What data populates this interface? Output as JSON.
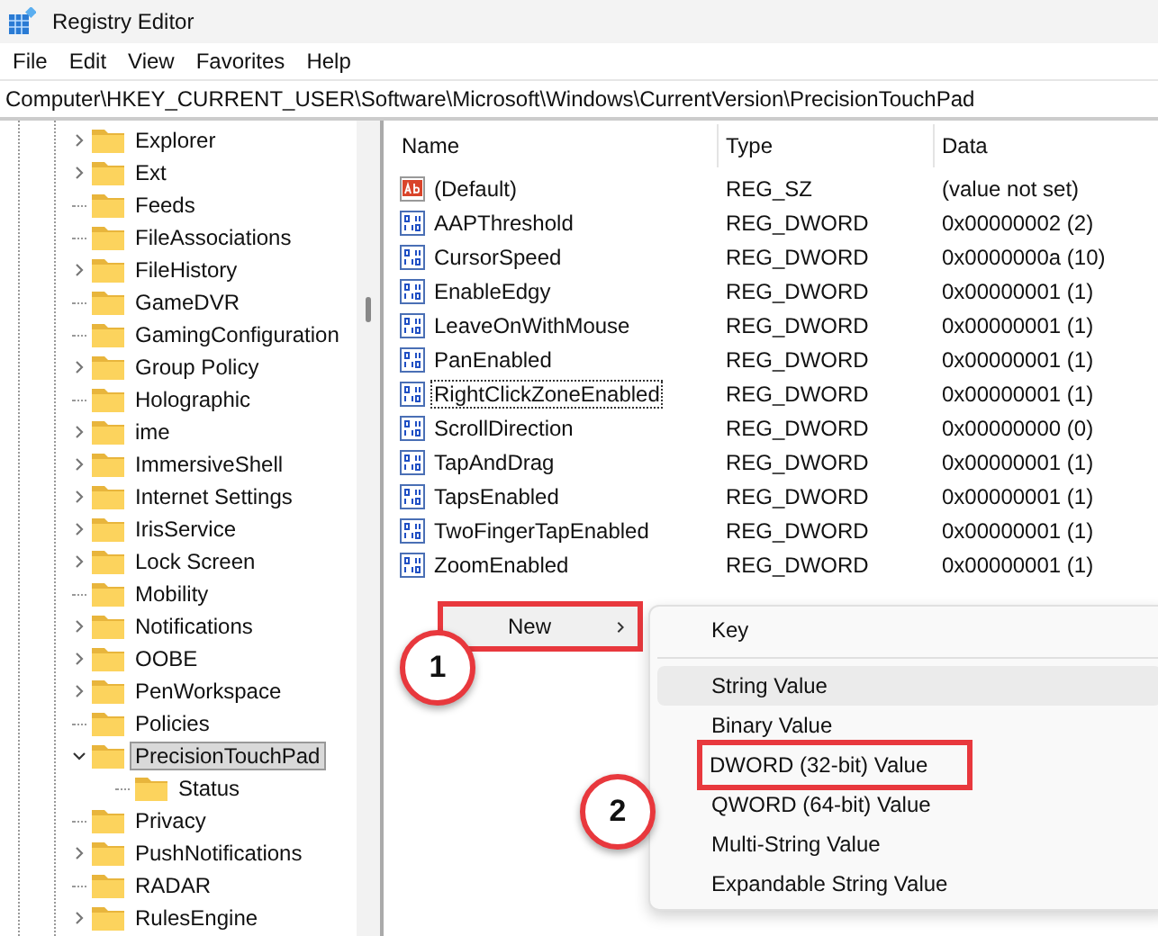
{
  "window": {
    "title": "Registry Editor"
  },
  "menu": [
    "File",
    "Edit",
    "View",
    "Favorites",
    "Help"
  ],
  "address": "Computer\\HKEY_CURRENT_USER\\Software\\Microsoft\\Windows\\CurrentVersion\\PrecisionTouchPad",
  "tree": [
    {
      "label": "Explorer",
      "expandable": true,
      "expanded": false,
      "selected": false
    },
    {
      "label": "Ext",
      "expandable": true,
      "expanded": false,
      "selected": false
    },
    {
      "label": "Feeds",
      "expandable": false,
      "expanded": false,
      "selected": false
    },
    {
      "label": "FileAssociations",
      "expandable": false,
      "expanded": false,
      "selected": false
    },
    {
      "label": "FileHistory",
      "expandable": true,
      "expanded": false,
      "selected": false
    },
    {
      "label": "GameDVR",
      "expandable": false,
      "expanded": false,
      "selected": false
    },
    {
      "label": "GamingConfiguration",
      "expandable": false,
      "expanded": false,
      "selected": false
    },
    {
      "label": "Group Policy",
      "expandable": true,
      "expanded": false,
      "selected": false
    },
    {
      "label": "Holographic",
      "expandable": false,
      "expanded": false,
      "selected": false
    },
    {
      "label": "ime",
      "expandable": true,
      "expanded": false,
      "selected": false
    },
    {
      "label": "ImmersiveShell",
      "expandable": true,
      "expanded": false,
      "selected": false
    },
    {
      "label": "Internet Settings",
      "expandable": true,
      "expanded": false,
      "selected": false
    },
    {
      "label": "IrisService",
      "expandable": true,
      "expanded": false,
      "selected": false
    },
    {
      "label": "Lock Screen",
      "expandable": true,
      "expanded": false,
      "selected": false
    },
    {
      "label": "Mobility",
      "expandable": false,
      "expanded": false,
      "selected": false
    },
    {
      "label": "Notifications",
      "expandable": true,
      "expanded": false,
      "selected": false
    },
    {
      "label": "OOBE",
      "expandable": true,
      "expanded": false,
      "selected": false
    },
    {
      "label": "PenWorkspace",
      "expandable": true,
      "expanded": false,
      "selected": false
    },
    {
      "label": "Policies",
      "expandable": false,
      "expanded": false,
      "selected": false
    },
    {
      "label": "PrecisionTouchPad",
      "expandable": true,
      "expanded": true,
      "selected": true,
      "children": [
        {
          "label": "Status",
          "expandable": false,
          "expanded": false,
          "selected": false
        }
      ]
    },
    {
      "label": "Privacy",
      "expandable": false,
      "expanded": false,
      "selected": false
    },
    {
      "label": "PushNotifications",
      "expandable": true,
      "expanded": false,
      "selected": false
    },
    {
      "label": "RADAR",
      "expandable": false,
      "expanded": false,
      "selected": false
    },
    {
      "label": "RulesEngine",
      "expandable": true,
      "expanded": false,
      "selected": false
    }
  ],
  "table": {
    "columns": [
      "Name",
      "Type",
      "Data"
    ],
    "rows": [
      {
        "kind": "string",
        "name": "(Default)",
        "type": "REG_SZ",
        "data": "(value not set)",
        "focused": false
      },
      {
        "kind": "dword",
        "name": "AAPThreshold",
        "type": "REG_DWORD",
        "data": "0x00000002 (2)",
        "focused": false
      },
      {
        "kind": "dword",
        "name": "CursorSpeed",
        "type": "REG_DWORD",
        "data": "0x0000000a (10)",
        "focused": false
      },
      {
        "kind": "dword",
        "name": "EnableEdgy",
        "type": "REG_DWORD",
        "data": "0x00000001 (1)",
        "focused": false
      },
      {
        "kind": "dword",
        "name": "LeaveOnWithMouse",
        "type": "REG_DWORD",
        "data": "0x00000001 (1)",
        "focused": false
      },
      {
        "kind": "dword",
        "name": "PanEnabled",
        "type": "REG_DWORD",
        "data": "0x00000001 (1)",
        "focused": false
      },
      {
        "kind": "dword",
        "name": "RightClickZoneEnabled",
        "type": "REG_DWORD",
        "data": "0x00000001 (1)",
        "focused": true
      },
      {
        "kind": "dword",
        "name": "ScrollDirection",
        "type": "REG_DWORD",
        "data": "0x00000000 (0)",
        "focused": false
      },
      {
        "kind": "dword",
        "name": "TapAndDrag",
        "type": "REG_DWORD",
        "data": "0x00000001 (1)",
        "focused": false
      },
      {
        "kind": "dword",
        "name": "TapsEnabled",
        "type": "REG_DWORD",
        "data": "0x00000001 (1)",
        "focused": false
      },
      {
        "kind": "dword",
        "name": "TwoFingerTapEnabled",
        "type": "REG_DWORD",
        "data": "0x00000001 (1)",
        "focused": false
      },
      {
        "kind": "dword",
        "name": "ZoomEnabled",
        "type": "REG_DWORD",
        "data": "0x00000001 (1)",
        "focused": false
      }
    ]
  },
  "context_menu": {
    "items": [
      {
        "label": "New",
        "submenu": true,
        "highlighted": true,
        "annotated": true
      }
    ]
  },
  "submenu": {
    "items": [
      {
        "kind": "item",
        "label": "Key",
        "highlighted": false,
        "annotated": false
      },
      {
        "kind": "separator"
      },
      {
        "kind": "item",
        "label": "String Value",
        "highlighted": true,
        "annotated": false
      },
      {
        "kind": "item",
        "label": "Binary Value",
        "highlighted": false,
        "annotated": false
      },
      {
        "kind": "item",
        "label": "DWORD (32-bit) Value",
        "highlighted": false,
        "annotated": true
      },
      {
        "kind": "item",
        "label": "QWORD (64-bit) Value",
        "highlighted": false,
        "annotated": false
      },
      {
        "kind": "item",
        "label": "Multi-String Value",
        "highlighted": false,
        "annotated": false
      },
      {
        "kind": "item",
        "label": "Expandable String Value",
        "highlighted": false,
        "annotated": false
      }
    ]
  },
  "callouts": [
    "1",
    "2"
  ]
}
